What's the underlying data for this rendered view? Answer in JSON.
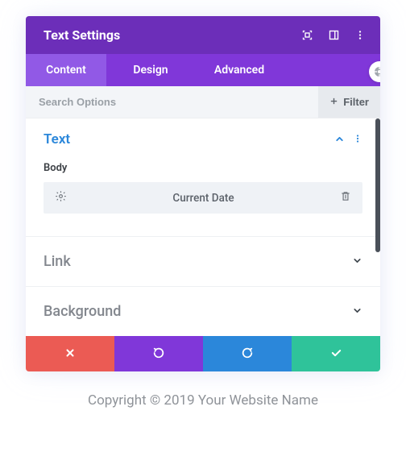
{
  "header": {
    "title": "Text Settings"
  },
  "tabs": {
    "content": "Content",
    "design": "Design",
    "advanced": "Advanced"
  },
  "search": {
    "placeholder": "Search Options",
    "filter_label": "Filter"
  },
  "sections": {
    "text": {
      "title": "Text",
      "body_label": "Body",
      "body_value": "Current Date"
    },
    "link": {
      "title": "Link"
    },
    "background": {
      "title": "Background"
    }
  },
  "footer": {
    "copyright": "Copyright © 2019 Your Website Name"
  },
  "colors": {
    "header": "#6c2eb9",
    "tabbar": "#8037d9",
    "tab_active": "#9159e6",
    "accent_blue": "#2b87da",
    "cancel": "#eb5b54",
    "undo": "#8037d9",
    "redo": "#2b87da",
    "save": "#2fc39a"
  }
}
